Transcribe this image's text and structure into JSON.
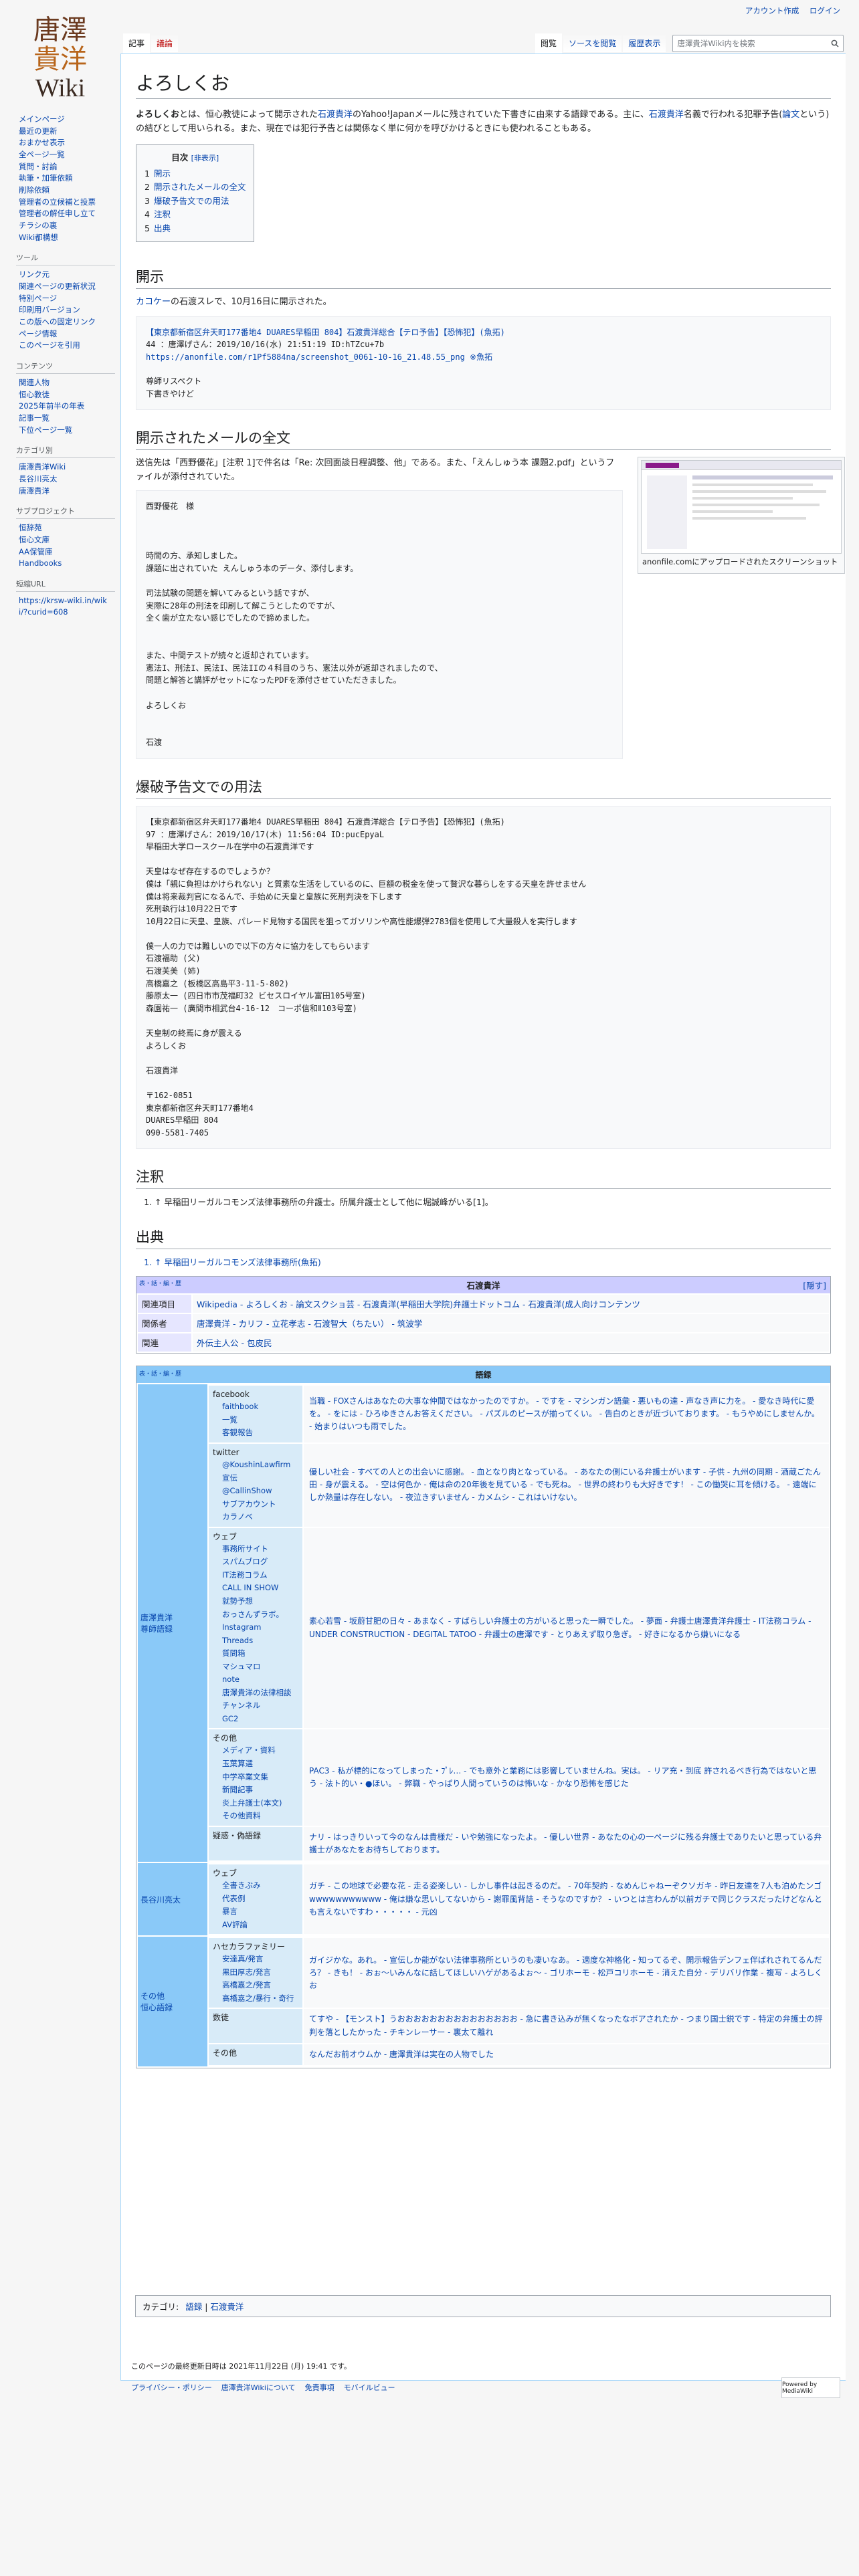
{
  "logo": {
    "line1": "唐澤",
    "line2": "貴洋",
    "line3": "Wiki"
  },
  "personal": {
    "talk": "アカウント作成",
    "login": "ログイン"
  },
  "tabs": {
    "article": "記事",
    "talk": "議論",
    "read": "閲覧",
    "edit": "ソースを閲覧",
    "history": "履歴表示"
  },
  "search": {
    "placeholder": "唐澤貴洋Wiki内を検索"
  },
  "sidebar": {
    "main": [
      "メインページ",
      "最近の更新",
      "おまかせ表示",
      "全ページ一覧",
      "質問・討論",
      "執筆・加筆依頼",
      "削除依頼",
      "管理者の立候補と投票",
      "管理者の解任申し立て",
      "チラシの裏",
      "Wiki都構想"
    ],
    "tools_h": "ツール",
    "tools": [
      "リンク元",
      "関連ページの更新状況",
      "特別ページ",
      "印刷用バージョン",
      "この版への固定リンク",
      "ページ情報",
      "このページを引用"
    ],
    "contents_h": "コンテンツ",
    "contents": [
      "関連人物",
      "恒心教徒",
      "2025年前半の年表",
      "記事一覧",
      "下位ページ一覧"
    ],
    "cat_h": "カテゴリ別",
    "cat": [
      "唐澤貴洋Wiki",
      "長谷川亮太",
      "唐澤貴洋"
    ],
    "sub_h": "サブプロジェクト",
    "sub": [
      "恒辞苑",
      "恒心文庫",
      "AA保管庫",
      "Handbooks"
    ],
    "short_h": "短縮URL",
    "short": "https://krsw-wiki.in/wiki/?curid=608"
  },
  "page": {
    "title": "よろしくお",
    "intro_bold": "よろしくお",
    "intro_1": "とは、恒心教徒によって開示された",
    "intro_link1": "石渡貴洋",
    "intro_2": "のYahoo!Japanメールに残されていた下書きに由来する語録である。主に、",
    "intro_link2": "石渡貴洋",
    "intro_3": "名義で行われる犯罪予告(",
    "intro_link3": "論文",
    "intro_4": "という)の結びとして用いられる。また、現在では犯行予告とは関係なく単に何かを呼びかけるときにも使われることもある。"
  },
  "toc": {
    "title": "目次",
    "toggle": "[非表示]",
    "items": [
      {
        "n": "1",
        "t": "開示"
      },
      {
        "n": "2",
        "t": "開示されたメールの全文"
      },
      {
        "n": "3",
        "t": "爆破予告文での用法"
      },
      {
        "n": "4",
        "t": "注釈"
      },
      {
        "n": "5",
        "t": "出典"
      }
    ]
  },
  "s1": {
    "h": "開示",
    "p_link": "カコケー",
    "p_text": "の石渡スレで、10月16日に開示された。",
    "q_head": "【東京都新宿区弁天町177番地4 DUARES早稲田 804】石渡貴洋総合【テロ予告】【恐怖犯】(魚拓)",
    "q_line": "44 ：唐澤げさん：2019/10/16(水) 21:51:19 ID:hTZcu+7b",
    "q_url": "https://anonfile.com/r1Pf5884na/screenshot_0061-10-16_21.48.55_png ※魚拓",
    "q_body1": "尊師リスペクト",
    "q_body2": "下書きやけど"
  },
  "s2": {
    "h": "開示されたメールの全文",
    "p": "送信先は「西野優花」[注釈 1]で件名は「Re: 次回面談日程調整、他」である。また、「えんしゅう本 課題2.pdf」というファイルが添付されていた。",
    "mail": "西野優花　様\n\n\n\n時間の方、承知しました。\n課題に出されていた えんしゅう本のデータ、添付します。\n\n司法試験の問題を解いてみるという話ですが、\n実際に28年の刑法を印刷して解こうとしたのですが、\n全く歯が立たない感じでしたので諦めました。\n\n\nまた、中間テストが続々と返却されています。\n憲法I、刑法I、民法I、民法IIの４科目のうち、憲法以外が返却されましたので、\n問題と解答と講評がセットになったPDFを添付させていただきました。\n\nよろしくお\n\n\n石渡",
    "caption": "anonfile.comにアップロードされたスクリーンショット"
  },
  "s3": {
    "h": "爆破予告文での用法",
    "text": "【東京都新宿区弁天町177番地4 DUARES早稲田 804】石渡貴洋総合【テロ予告】【恐怖犯】(魚拓)\n97 ：唐澤げさん：2019/10/17(木) 11:56:04 ID:pucEpyaL\n早稲田大学ロースクール在学中の石渡貴洋です\n\n天皇はなぜ存在するのでしょうか？\n僕は「親に負担はかけられない」と質素な生活をしているのに、巨額の税金を使って贅沢な暮らしをする天皇を許せません\n僕は将来裁判官になるんで、手始めに天皇と皇族に死刑判決を下します\n死刑執行は10月22日です\n10月22日に天皇、皇族、パレード見物する国民を狙ってガソリンや高性能爆弾2783個を使用して大量殺人を実行します\n\n僕一人の力では難しいので以下の方々に協力をしてもらいます\n石渡福助 (父)\n石渡芙美 (姉)\n高橋嘉之 (板橋区高島平3-11-5-802)\n藤原太一 (四日市市茂福町32 ビセスロイヤル富田105号室)\n森園祐一 (廣間市相武台4-16-12　コーポ信和Ⅱ103号室)\n\n天皇制の終焉に身が震える\nよろしくお\n\n石渡貴洋\n\n〒162-0851\n東京都新宿区弁天町177番地4\nDUARES早稲田 804\n090-5581-7405"
  },
  "s4": {
    "h": "注釈",
    "ref": "↑ 早稲田リーガルコモンズ法律事務所の弁護士。所属弁護士として他に堀誠峰がいる[1]。"
  },
  "s5": {
    "h": "出典",
    "ref": "↑ 早稲田リーガルコモンズ法律事務所(魚拓)"
  },
  "navbox1": {
    "v": "表・話・編・歴",
    "title": "石渡貴洋",
    "hide": "[隠す]",
    "rows": [
      {
        "k": "関連項目",
        "v": "Wikipedia - よろしくお - 論文スクショ芸 - 石渡貴洋(早稲田大学院)弁護士ドットコム - 石渡貴洋(成人向けコンテンツ"
      },
      {
        "k": "関係者",
        "v": "唐澤貴洋 - カリフ - 立花孝志 - 石渡智大（ちたい） - 筑波学"
      },
      {
        "k": "関連",
        "v": "外伝主人公 - 包皮民"
      }
    ]
  },
  "navbox2": {
    "v": "表・話・編・歴",
    "title": "語録",
    "groups": [
      {
        "name": "唐澤貴洋\n尊師語録",
        "subs": [
          {
            "t": "facebook",
            "c": [
              "faithbook",
              "一覧",
              "客観報告"
            ],
            "v": "当職 - FOXさんはあなたの大事な仲間ではなかったのですか。 - ですを - マシンガン語彙 - 悪いもの達 - 声なき声に力を。 - 愛なき時代に愛を。 - をには - ひろゆきさんお答えください。 - パズルのピースが揃ってくい。 - 告白のときが近づいております。 - もうやめにしませんか。 - 始まりはいつも雨でした。"
          },
          {
            "t": "twitter",
            "c": [
              "@KoushinLawfirm",
              "宣伝",
              "@CallinShow",
              "サブアカウント",
              "カラノベ"
            ],
            "v": "優しい社会 - すべての人との出会いに感謝。 - 血となり肉となっている。 - あなたの側にいる弁護士がいます - 子供 - 九州の同期 - 酒蔵ごたん田 - 身が震える。 - 空は何色か - 俺は命の20年後を見ている - でも死ね。 - 世界の終わりも大好きです！ - この慟哭に耳を傾ける。 - 遠端にしか熱量は存在しない。 - 夜泣きすいません - カメムシ - これはいけない。"
          },
          {
            "t": "ウェブ",
            "c": [
              "事務所サイト",
              "スパムブログ",
              "IT法務コラム",
              "CALL IN SHOW",
              "就勢予想",
              "おっさんずラボ。",
              "Instagram",
              "Threads",
              "質問箱",
              "マシュマロ",
              "note",
              "唐澤貴洋の法律相談チャンネル",
              "GC2"
            ],
            "v": "素心若雪 - 坂蔚甘肥の日々 - あまなく - すばらしい弁護士の方がいると思った一瞬でした。 - 夢面 - 弁護士唐澤貴洋弁護士 - IT法務コラム - UNDER CONSTRUCTION - DEGITAL TATOO - 弁護士の唐澤です - とりあえず取り急ぎ。 - 好きになるから嫌いになる"
          },
          {
            "t": "その他",
            "c": [
              "メディア・資料",
              "玉葉算選",
              "中学卒業文集",
              "新聞記事",
              "炎上弁護士(本文)",
              "その他資料"
            ],
            "v": "PAC3 - 私が標的になってしまった・ﾌﾟﾚ… - でも意外と業務には影響していませんね。実は。 - リア充・到底 許されるべき行為ではないと思う - 法ト的い・●ほい。 - 弊職 - やっぱり人間っていうのは怖いな - かなり恐怖を感じた"
          },
          {
            "t": "疑惑・偽語録",
            "c": [],
            "v": "ナリ - はっきりいって今のなんは貴様だ - いや勉強になったよ。 - 優しい世界 - あなたの心の一ページに残る弁護士でありたいと思っている弁護士があなたをお待ちしております。"
          }
        ]
      },
      {
        "name": "長谷川亮太",
        "subs": [
          {
            "t": "ウェブ",
            "c": [
              "全書きぶみ",
              "代表例",
              "暴言",
              "AV評論"
            ],
            "v": "ガチ - この地球で必要な花 - 走る姿楽しい - しかし事件は起きるのだ。 - 70年契約 - なめんじゃねーぞクソガキ - 昨日友達を7人も泊めたンゴwwwwwwwwwww - 俺は嫌な思いしてないから - 謝罪風背詰 - そうなのですか？ - いつとは言わんが以前ガチで同じクラスだったけどなんとも言えないですわ・・・・・ - 元凶"
          }
        ]
      },
      {
        "name": "その他\n恒心語録",
        "subs": [
          {
            "t": "ハセカラファミリー",
            "c": [
              "安達真/発言",
              "黒田厚志/発言",
              "高橋嘉之/発言",
              "高橋嘉之/暴行・奇行"
            ],
            "v": "ガイジかな。あれ。 - 宣伝しか能がない法律事務所というのも凄いなあ。 - 適度な神格化 - 知ってるぞ、開示報告デンフェ伴ばれされてるんだろ？ - きも！ - おぉ～いみんなに話してほしいハゲがあるよぉ～ - ゴリホーモ - 松戸コリホーモ - 消えた自分 - デリバリ作業 - 複写 - よろしくお"
          },
          {
            "t": "数徒",
            "c": [],
            "v": "てすや - 【モンスト】うおおおおおおおおおおおおおおお - 急に書き込みが無くなったなボアされたか - つまり国士鋭です - 特定の弁護士の評判を落としたかった - チキンレーサー - 裏太て離れ"
          },
          {
            "t": "その他",
            "c": [],
            "v": "なんだお前オウムか - 唐澤貴洋は実在の人物でした"
          }
        ]
      }
    ]
  },
  "catlinks": {
    "label": "カテゴリ:",
    "items": [
      "語録",
      "石渡貴洋"
    ]
  },
  "footer": {
    "modified": "このページの最終更新日時は 2021年11月22日 (月) 19:41 です。",
    "links": [
      "プライバシー・ポリシー",
      "唐澤貴洋Wikiについて",
      "免責事項",
      "モバイルビュー"
    ],
    "powered": "Powered by MediaWiki"
  }
}
